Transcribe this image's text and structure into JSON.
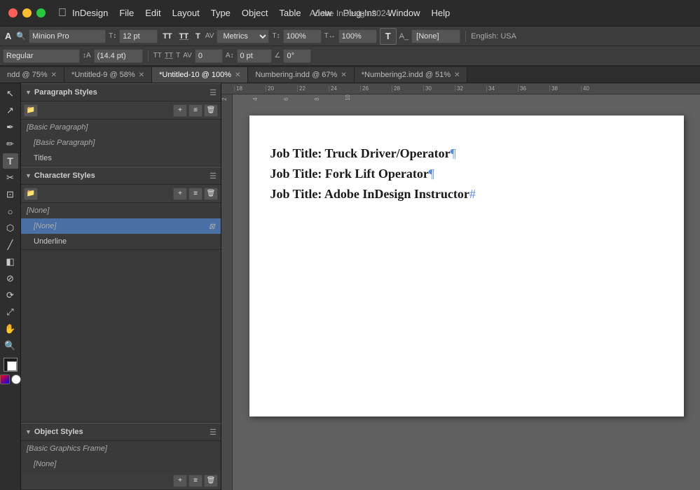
{
  "app": {
    "name": "InDesign",
    "title": "Adobe InDesign 2024"
  },
  "menu": {
    "apple_label": "",
    "items": [
      "InDesign",
      "File",
      "Edit",
      "Layout",
      "Type",
      "Object",
      "Table",
      "View",
      "Plug-Ins",
      "Window",
      "Help"
    ]
  },
  "toolbar_row1": {
    "font_family": "Minion Pro",
    "font_size": "12 pt",
    "metrics_label": "Metrics",
    "horizontal_scale": "100%",
    "vertical_scale": "100%",
    "t_icon_label": "T",
    "none_label": "[None]",
    "lang_label": "English: USA"
  },
  "toolbar_row2": {
    "font_style": "Regular",
    "leading": "(14.4 pt)",
    "baseline": "0 pt",
    "angle": "0°"
  },
  "tabs": [
    {
      "label": "ndd @ 75%",
      "active": false,
      "closable": true
    },
    {
      "label": "*Untitled-9 @ 58%",
      "active": false,
      "closable": true
    },
    {
      "label": "*Untitled-10 @ 100%",
      "active": true,
      "closable": true
    },
    {
      "label": "Numbering.indd @ 67%",
      "active": false,
      "closable": true
    },
    {
      "label": "*Numbering2.indd @ 51%",
      "active": false,
      "closable": true
    }
  ],
  "paragraph_styles": {
    "title": "Paragraph Styles",
    "items": [
      {
        "label": "[Basic Paragraph]",
        "type": "bracket",
        "selected": false
      },
      {
        "label": "[Basic Paragraph]",
        "type": "bracket",
        "selected": false
      },
      {
        "label": "Titles",
        "type": "normal",
        "selected": false
      }
    ]
  },
  "character_styles": {
    "title": "Character Styles",
    "items": [
      {
        "label": "[None]",
        "type": "bracket",
        "selected": false
      },
      {
        "label": "[None]",
        "type": "bracket",
        "selected": true
      },
      {
        "label": "Underline",
        "type": "normal",
        "selected": false
      }
    ]
  },
  "object_styles": {
    "title": "Object Styles",
    "items": [
      {
        "label": "[Basic Graphics Frame]",
        "type": "bracket",
        "selected": false
      },
      {
        "label": "[None]",
        "type": "bracket",
        "selected": false
      }
    ]
  },
  "canvas": {
    "document_lines": [
      {
        "text": "Job Title: Truck Driver/Operator",
        "has_pilcrow": true,
        "pilcrow": "¶"
      },
      {
        "text": "Job Title: Fork Lift Operator",
        "has_pilcrow": true,
        "pilcrow": "¶"
      },
      {
        "text": "Job Title: Adobe InDesign Instructor",
        "has_pilcrow": true,
        "pilcrow": "#"
      }
    ]
  },
  "ruler": {
    "ticks": [
      "18",
      "20",
      "22",
      "24",
      "26",
      "28",
      "30",
      "32",
      "34",
      "36",
      "38",
      "40"
    ]
  },
  "tools": [
    "↖",
    "▷",
    "✒",
    "✏",
    "T",
    "✂",
    "⊡",
    "○",
    "⬡",
    "≋",
    "✦",
    "⌖",
    "✳",
    "◫",
    "⟲",
    "🔍"
  ]
}
